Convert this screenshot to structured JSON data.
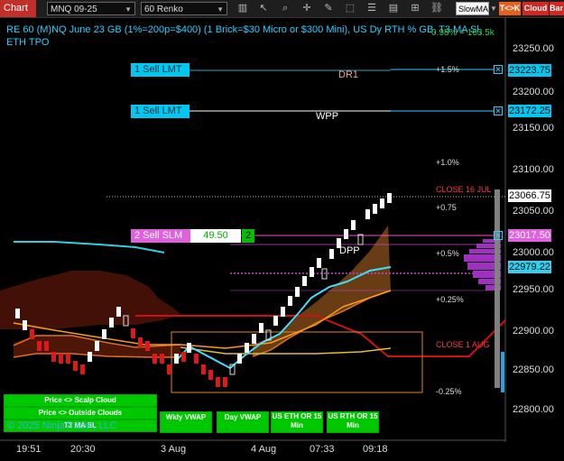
{
  "toolbar": {
    "chart_tab": "Chart",
    "instrument": "MNQ 09-25",
    "bar_type": "60 Renko",
    "indicator_select": "SlowMA",
    "tck_label": "T<>K",
    "cloud_label": "Cloud",
    "bar_label": "Bar"
  },
  "title": {
    "line1": "RE 60 (M)NQ June 23 GB (1%=200p=$400) (1 Brick=$30 Micro or $300 Mini), US Dy RTH % GB, T3 MA Sl,",
    "line2": "ETH TPO",
    "corner": "0.98% = 163.5k"
  },
  "orders": [
    {
      "label": "1 Sell LMT",
      "price": "23223.75",
      "level_label": "DR1"
    },
    {
      "label": "1 Sell LMT",
      "price": "23172.25",
      "level_label": "WPP"
    },
    {
      "label": "2 Sell SLM",
      "price": "23017.50",
      "value": "49.50",
      "qty": "2"
    }
  ],
  "price_axis": [
    "23250.00",
    "23200.00",
    "23150.00",
    "23100.00",
    "23050.00",
    "23000.00",
    "22950.00",
    "22900.00",
    "22850.00",
    "22800.00"
  ],
  "price_tags": {
    "last": "23066.75",
    "vwap": "22979.22"
  },
  "levels": {
    "plus15": "+1.5%",
    "plus10": "+1.0%",
    "plus075": "+0.75",
    "plus05": "+0.5%",
    "plus025": "+0.25%",
    "minus025": "-0.25%",
    "close16": "CLOSE 16 JUL",
    "close1": "CLOSE 1 AUG",
    "dpp": "DPP"
  },
  "time_axis": [
    "19:51",
    "20:30",
    "3 Aug",
    "4 Aug",
    "07:33",
    "09:18"
  ],
  "buttons": {
    "scalp_cloud": "Price <> Scalp Cloud",
    "outside_clouds": "Price <> Outside Clouds",
    "t3_ma_sl": "T3 MA SL",
    "wkly_vwap": "Wkly VWAP",
    "day_vwap": "Day VWAP",
    "us_eth": "US ETH OR 15 Min",
    "us_rth": "US RTH OR 15 Min"
  },
  "copyright": "© 2025 NinjaTrader, LLC",
  "colors": {
    "accent": "#2ad0ff",
    "up": "#ffffff",
    "down": "#e01818",
    "cloud": "#6a1a0a",
    "vwap": "#ff9a1a",
    "fast_ma": "#40e0ff"
  }
}
